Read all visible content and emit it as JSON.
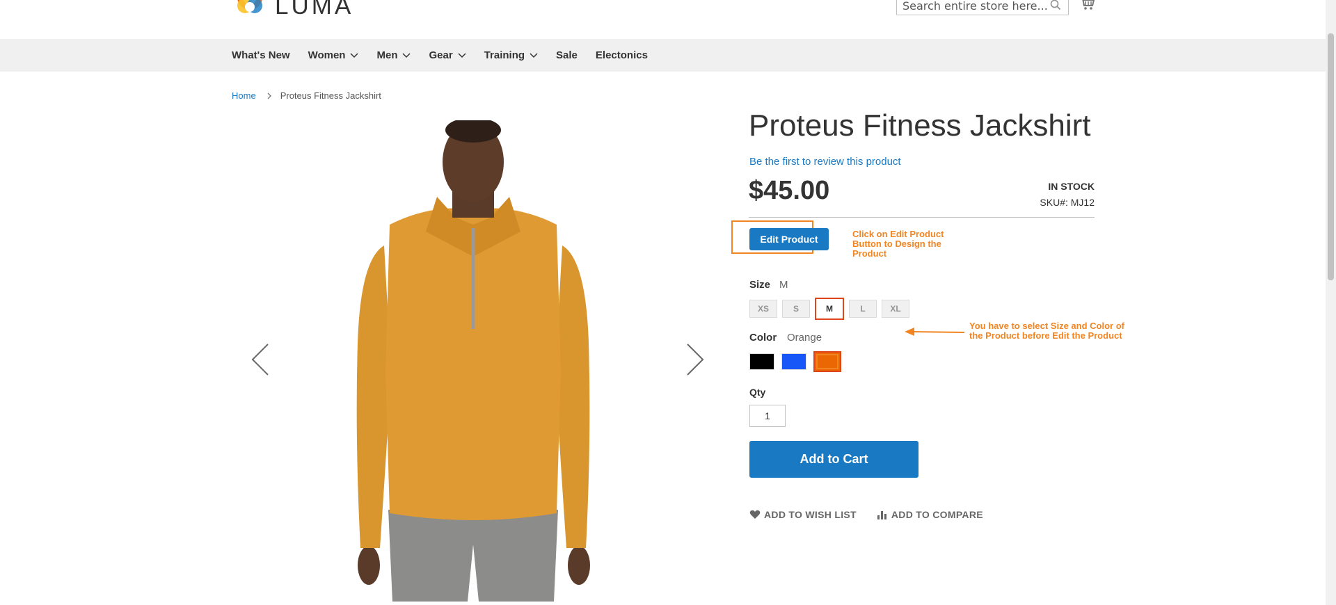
{
  "header": {
    "logo_text": "LUMA",
    "search_placeholder": "Search entire store here...",
    "colors": {
      "logo_ring_1": "#f26322",
      "logo_ring_2": "#f9c32b",
      "logo_ring_3": "#2583c6"
    }
  },
  "nav": {
    "items": [
      {
        "label": "What's New",
        "dropdown": false
      },
      {
        "label": "Women",
        "dropdown": true
      },
      {
        "label": "Men",
        "dropdown": true
      },
      {
        "label": "Gear",
        "dropdown": true
      },
      {
        "label": "Training",
        "dropdown": true
      },
      {
        "label": "Sale",
        "dropdown": false
      },
      {
        "label": "Electonics",
        "dropdown": false
      }
    ]
  },
  "breadcrumb": {
    "home": "Home",
    "current": "Proteus Fitness Jackshirt"
  },
  "product": {
    "title": "Proteus Fitness Jackshirt",
    "review_link": "Be the first to review this product",
    "price": "$45.00",
    "stock": "IN STOCK",
    "sku": "SKU#:  MJ12",
    "edit_button": "Edit Product",
    "edit_note": "Click on Edit Product Button to Design the Product",
    "select_note": "You have to select Size and Color of the Product before Edit the Product",
    "size_label": "Size",
    "size_value": "M",
    "sizes": [
      "XS",
      "S",
      "M",
      "L",
      "XL"
    ],
    "selected_size": "M",
    "color_label": "Color",
    "color_value": "Orange",
    "colors": [
      {
        "name": "Black",
        "hex": "#000000"
      },
      {
        "name": "Blue",
        "hex": "#1857f7"
      },
      {
        "name": "Orange",
        "hex": "#eb6703"
      }
    ],
    "selected_color": "Orange",
    "qty_label": "Qty",
    "qty_value": "1",
    "add_to_cart": "Add to Cart",
    "wish_list": "ADD TO WISH LIST",
    "compare": "ADD TO COMPARE"
  },
  "annotation_color": "#f08522",
  "accent_color": "#1979c3"
}
